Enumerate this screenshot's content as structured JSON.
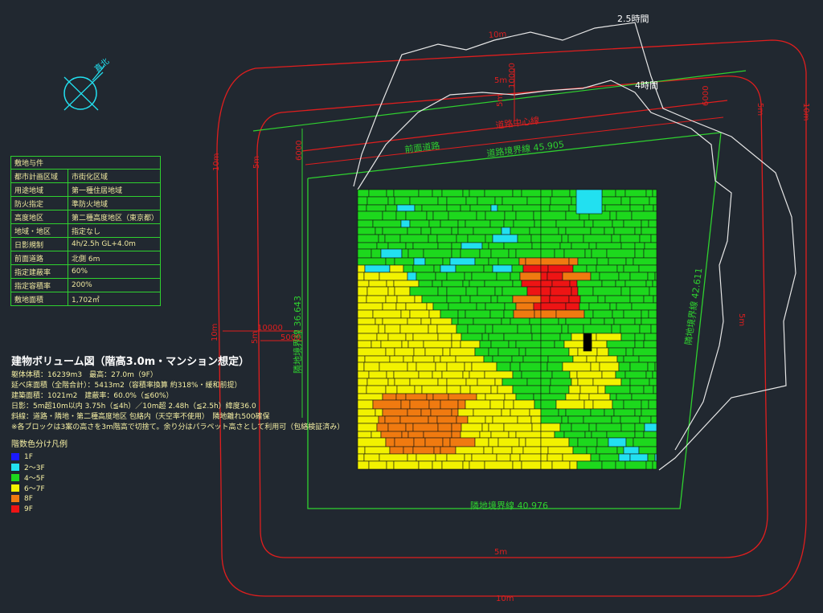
{
  "compass": {
    "label": "真北"
  },
  "site_conditions": {
    "header": "敷地与件",
    "rows": [
      {
        "key": "都市計画区域",
        "value": "市街化区域"
      },
      {
        "key": "用途地域",
        "value": "第一種住居地域"
      },
      {
        "key": "防火指定",
        "value": "準防火地域"
      },
      {
        "key": "高度地区",
        "value": "第二種高度地区（東京都）"
      },
      {
        "key": "地域・地区",
        "value": "指定なし"
      },
      {
        "key": "日影規制",
        "value": "4h/2.5h GL+4.0m"
      },
      {
        "key": "前面道路",
        "value": "北側 6m"
      },
      {
        "key": "指定建蔽率",
        "value": "60%"
      },
      {
        "key": "指定容積率",
        "value": "200%"
      },
      {
        "key": "敷地面積",
        "value": "1,702㎡"
      }
    ]
  },
  "info": {
    "title": "建物ボリューム図（階高3.0m・マンション想定）",
    "lines": [
      "躯体体積：16239m3　最高：27.0m（9F）",
      "延べ床面積（全階合計）：5413m2（容積率換算 約318%・緩和前提）",
      "建築面積：1021m2　建蔽率：60.0%（≦60%）",
      "日影：5m超10m以内 3.75h（≦4h）／10m超 2.48h（≦2.5h）緯度36.0",
      "斜線：道路・隣地・第二種高度地区 包絡内（天空率不使用）　隣地離れ500確保",
      "※各ブロックは3案の高さを3m階高で切捨て。余り分はパラペット高さとして利用可（包絡検証済み）"
    ]
  },
  "legend": {
    "title": "階数色分け凡例",
    "items": [
      {
        "label": "1F",
        "color": "#1a1aff"
      },
      {
        "label": "2〜3F",
        "color": "#22e0f0"
      },
      {
        "label": "4〜5F",
        "color": "#1dd81d"
      },
      {
        "label": "6〜7F",
        "color": "#f2f200"
      },
      {
        "label": "8F",
        "color": "#f07a10"
      },
      {
        "label": "9F",
        "color": "#ee1414"
      }
    ]
  },
  "drawing": {
    "road_center": "道路中心線",
    "front_road": "前面道路",
    "road_boundary": "道路境界線 45.905",
    "adj_boundary_left": "隣地境界線 36.643",
    "adj_boundary_right": "隣地境界線 42.611",
    "adj_boundary_bottom": "隣地境界線 40.976",
    "shadow_25h": "2.5時間",
    "shadow_4h": "4時間",
    "dim_10m": "10m",
    "dim_5m": "5m",
    "dim_6000": "6000",
    "dim_5000": "5000",
    "dim_10000": "10000",
    "dim_10000v": "10000"
  }
}
